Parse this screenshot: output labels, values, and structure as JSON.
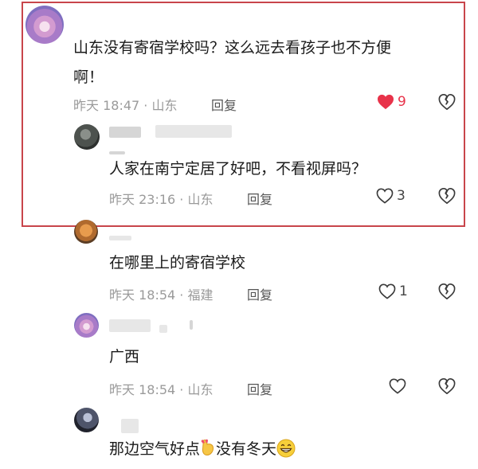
{
  "comments": [
    {
      "text_line1": "山东没有寄宿学校吗？这么远去看孩子也不方便",
      "text_line2": "啊！",
      "meta": "昨天 18:47 · 山东",
      "reply": "回复",
      "likes": "9",
      "liked": true
    },
    {
      "text": "人家在南宁定居了好吧，不看视屏吗？",
      "meta": "昨天 23:16 · 山东",
      "reply": "回复",
      "likes": "3",
      "liked": false
    },
    {
      "text": "在哪里上的寄宿学校",
      "meta": "昨天 18:54 · 福建",
      "reply": "回复",
      "likes": "1",
      "liked": false
    },
    {
      "text": "广西",
      "meta": "昨天 18:54 · 山东",
      "reply": "回复",
      "likes": "",
      "liked": false
    },
    {
      "text_part1": "那边空气好点",
      "text_part2": "没有冬天"
    }
  ],
  "colors": {
    "highlight_border": "#c8454b",
    "like_active": "#e8334a",
    "meta_text": "#9a9a9a"
  },
  "icons": [
    "heart-icon",
    "dislike-icon",
    "emoji-hand",
    "emoji-grin"
  ]
}
